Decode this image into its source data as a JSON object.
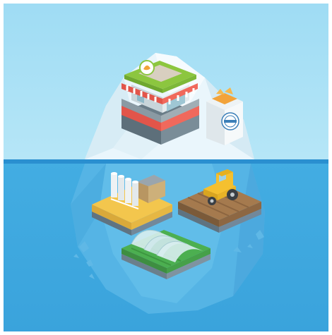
{
  "scene": {
    "colors": {
      "sky": "#aee2f6",
      "sky_top": "#9fdcf4",
      "water": "#3da7df",
      "water_deep": "#2f95d0",
      "waterline": "#2a8fd0",
      "ice": "#e9f5fb",
      "ice_shadow": "#cfe7f2",
      "ice_underwater": "#5bb8e6"
    },
    "tip_items": [
      {
        "name": "retail-store",
        "icon": "store-icon"
      },
      {
        "name": "certified-package",
        "icon": "package-icon"
      }
    ],
    "underwater_items": [
      {
        "name": "silo-processing-plant",
        "icon": "silo-icon"
      },
      {
        "name": "tractor-farm-field",
        "icon": "tractor-icon"
      },
      {
        "name": "greenhouse-farm",
        "icon": "greenhouse-icon"
      }
    ]
  }
}
